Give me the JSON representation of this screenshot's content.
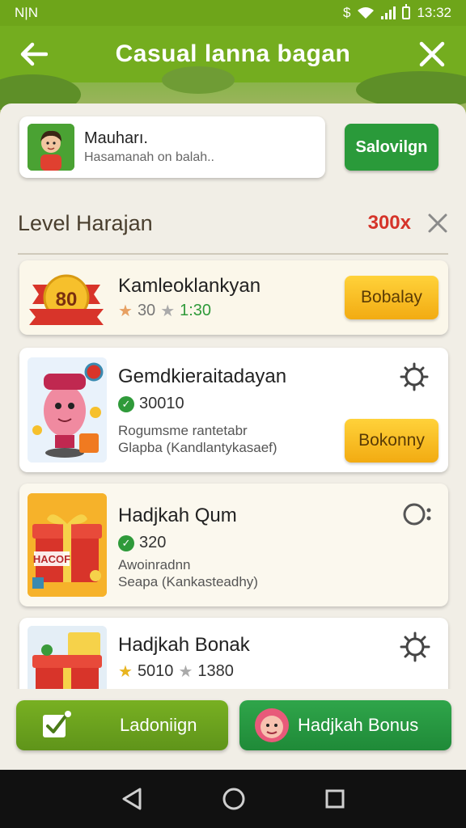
{
  "status_bar": {
    "left": "N|N",
    "dollar": "$",
    "time": "13:32"
  },
  "app_bar": {
    "title": "Casual lanna bagan",
    "back_icon": "arrow-left-icon",
    "close_icon": "close-icon"
  },
  "profile": {
    "name": "Mauharı.",
    "subtitle": "Hasamanah on balah..",
    "action_label": "Salovilgn"
  },
  "section": {
    "title": "Level Harajan",
    "count": "300x"
  },
  "cards": [
    {
      "title": "Kamleoklankyan",
      "badge_text": "80",
      "stats_a": "30",
      "stats_b": "1:30",
      "button": "Bobalay"
    },
    {
      "title": "Gemdkieraitadayan",
      "stats_a": "30010",
      "desc_1": "Rogumsme rantetabr",
      "desc_2": "Glapba (Kandlantykasaef)",
      "button": "Bokonny"
    },
    {
      "title": "Hadjkah Qum",
      "stats_a": "320",
      "desc_1": "Awoinradnn",
      "desc_2": "Seapa (Kankasteadhy)",
      "gift_label": "HACOF"
    },
    {
      "title": "Hadjkah Bonak",
      "stats_a": "5010",
      "stats_b": "1380"
    }
  ],
  "bottom": {
    "left_label": "Ladoniign",
    "right_label": "Hadjkah Bonus"
  },
  "colors": {
    "green": "#74ad1f",
    "button_green": "#2a9a3a",
    "yellow": "#f2ab12",
    "red": "#d5342a"
  }
}
